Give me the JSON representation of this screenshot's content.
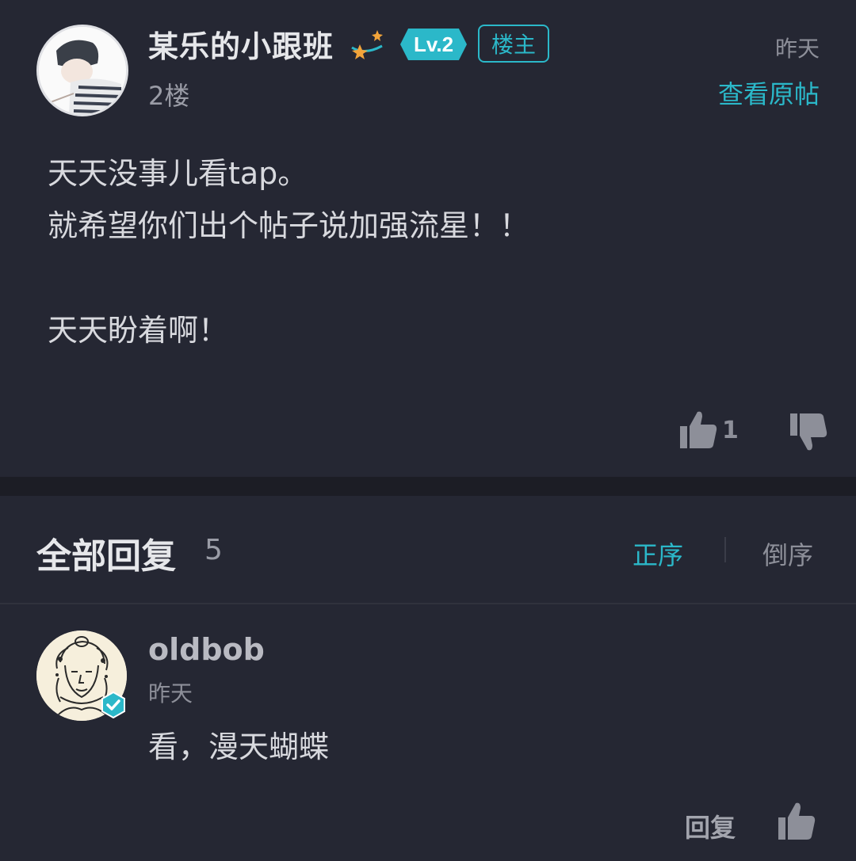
{
  "post": {
    "author": "某乐的小跟班",
    "level": "Lv.2",
    "badge": "楼主",
    "floor": "2楼",
    "time": "昨天",
    "view_original": "查看原帖",
    "content_lines": [
      "天天没事儿看tap。",
      "就希望你们出个帖子说加强流星！！",
      "",
      "天天盼着啊！"
    ],
    "like_count": "1"
  },
  "replies_header": {
    "title": "全部回复",
    "count": "5",
    "sort_asc": "正序",
    "sort_desc": "倒序"
  },
  "reply": {
    "author": "oldbob",
    "time": "昨天",
    "content": "看，漫天蝴蝶",
    "reply_label": "回复"
  },
  "colors": {
    "background": "#252733",
    "accent": "#2bb8c9",
    "divider": "#1c1d25"
  }
}
